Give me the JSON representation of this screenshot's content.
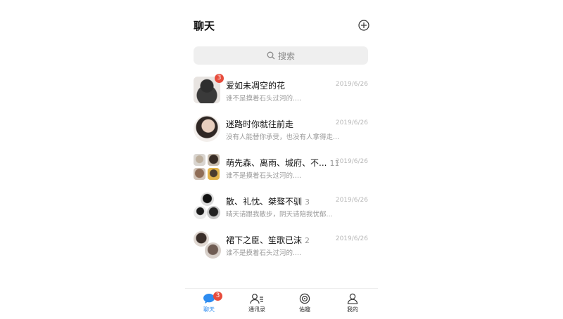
{
  "header": {
    "title": "聊天",
    "add_icon": "plus-circle-icon"
  },
  "search": {
    "label": "搜索",
    "icon": "search-icon"
  },
  "chats": [
    {
      "name": "爱如未凋空的花",
      "count": "",
      "preview": "谁不是摸着石头过河的....",
      "time": "2019/6/26",
      "badge": "3"
    },
    {
      "name": "迷路时你就往前走",
      "count": "",
      "preview": "没有人能替你承受，也没有人拿得走...",
      "time": "2019/6/26",
      "badge": ""
    },
    {
      "name": "萌先森、离雨、城府、不...",
      "count": "11",
      "preview": "谁不是摸着石头过河的....",
      "time": "2019/6/26",
      "badge": ""
    },
    {
      "name": "散、礼忱、桀骜不驯",
      "count": "3",
      "preview": "晴天请跟我散步，阴天请陪我忧郁...",
      "time": "2019/6/26",
      "badge": ""
    },
    {
      "name": "裙下之臣、笙歌已沫",
      "count": "2",
      "preview": "谁不是摸着石头过河的....",
      "time": "2019/6/26",
      "badge": ""
    }
  ],
  "tabs": [
    {
      "label": "聊天",
      "icon": "chat-bubble-icon",
      "badge": "3",
      "active": true
    },
    {
      "label": "通讯录",
      "icon": "contacts-icon",
      "badge": ""
    },
    {
      "label": "佑趣",
      "icon": "discover-icon",
      "badge": ""
    },
    {
      "label": "我的",
      "icon": "profile-icon",
      "badge": ""
    }
  ],
  "colors": {
    "accent": "#2d8cf0",
    "badge": "#e74c3c"
  }
}
